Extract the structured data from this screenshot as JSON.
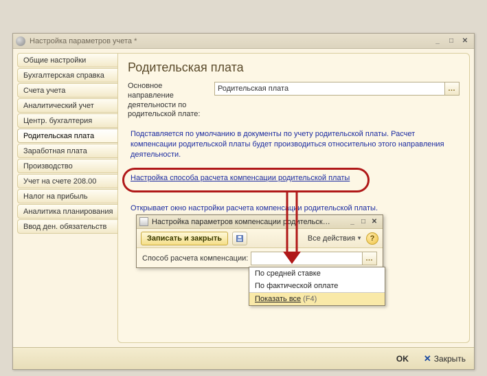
{
  "window": {
    "title": "Настройка параметров учета *"
  },
  "sidebar": {
    "items": [
      {
        "label": "Общие настройки"
      },
      {
        "label": "Бухгалтерская справка"
      },
      {
        "label": "Счета учета"
      },
      {
        "label": "Аналитический учет"
      },
      {
        "label": "Центр. бухгалтерия"
      },
      {
        "label": "Родительская плата"
      },
      {
        "label": "Заработная плата"
      },
      {
        "label": "Производство"
      },
      {
        "label": "Учет на счете 208.00"
      },
      {
        "label": "Налог на прибыль"
      },
      {
        "label": "Аналитика планирования"
      },
      {
        "label": "Ввод ден. обязательств"
      }
    ],
    "active_index": 5
  },
  "main": {
    "title": "Родительская плата",
    "field_label": "Основное направление деятельности по родительской плате:",
    "field_value": "Родительская плата",
    "help1": "Подставляется по умолчанию в документы по учету родительской платы. Расчет компенсации родительской платы будет производиться относительно этого направления деятельности.",
    "link": "Настройка способа расчета компенсации родительской платы",
    "help2": "Открывает окно настройки расчета компенсации родительской платы."
  },
  "subwindow": {
    "title": "Настройка параметров компенсации родительск…",
    "write_close": "Записать и закрыть",
    "all_actions": "Все действия",
    "field_label": "Способ расчета компенсации:",
    "field_value": ""
  },
  "dropdown": {
    "options": [
      "По средней ставке",
      "По фактической оплате"
    ],
    "show_all": "Показать все",
    "show_all_key": "(F4)"
  },
  "footer": {
    "ok": "OK",
    "close": "Закрыть"
  }
}
